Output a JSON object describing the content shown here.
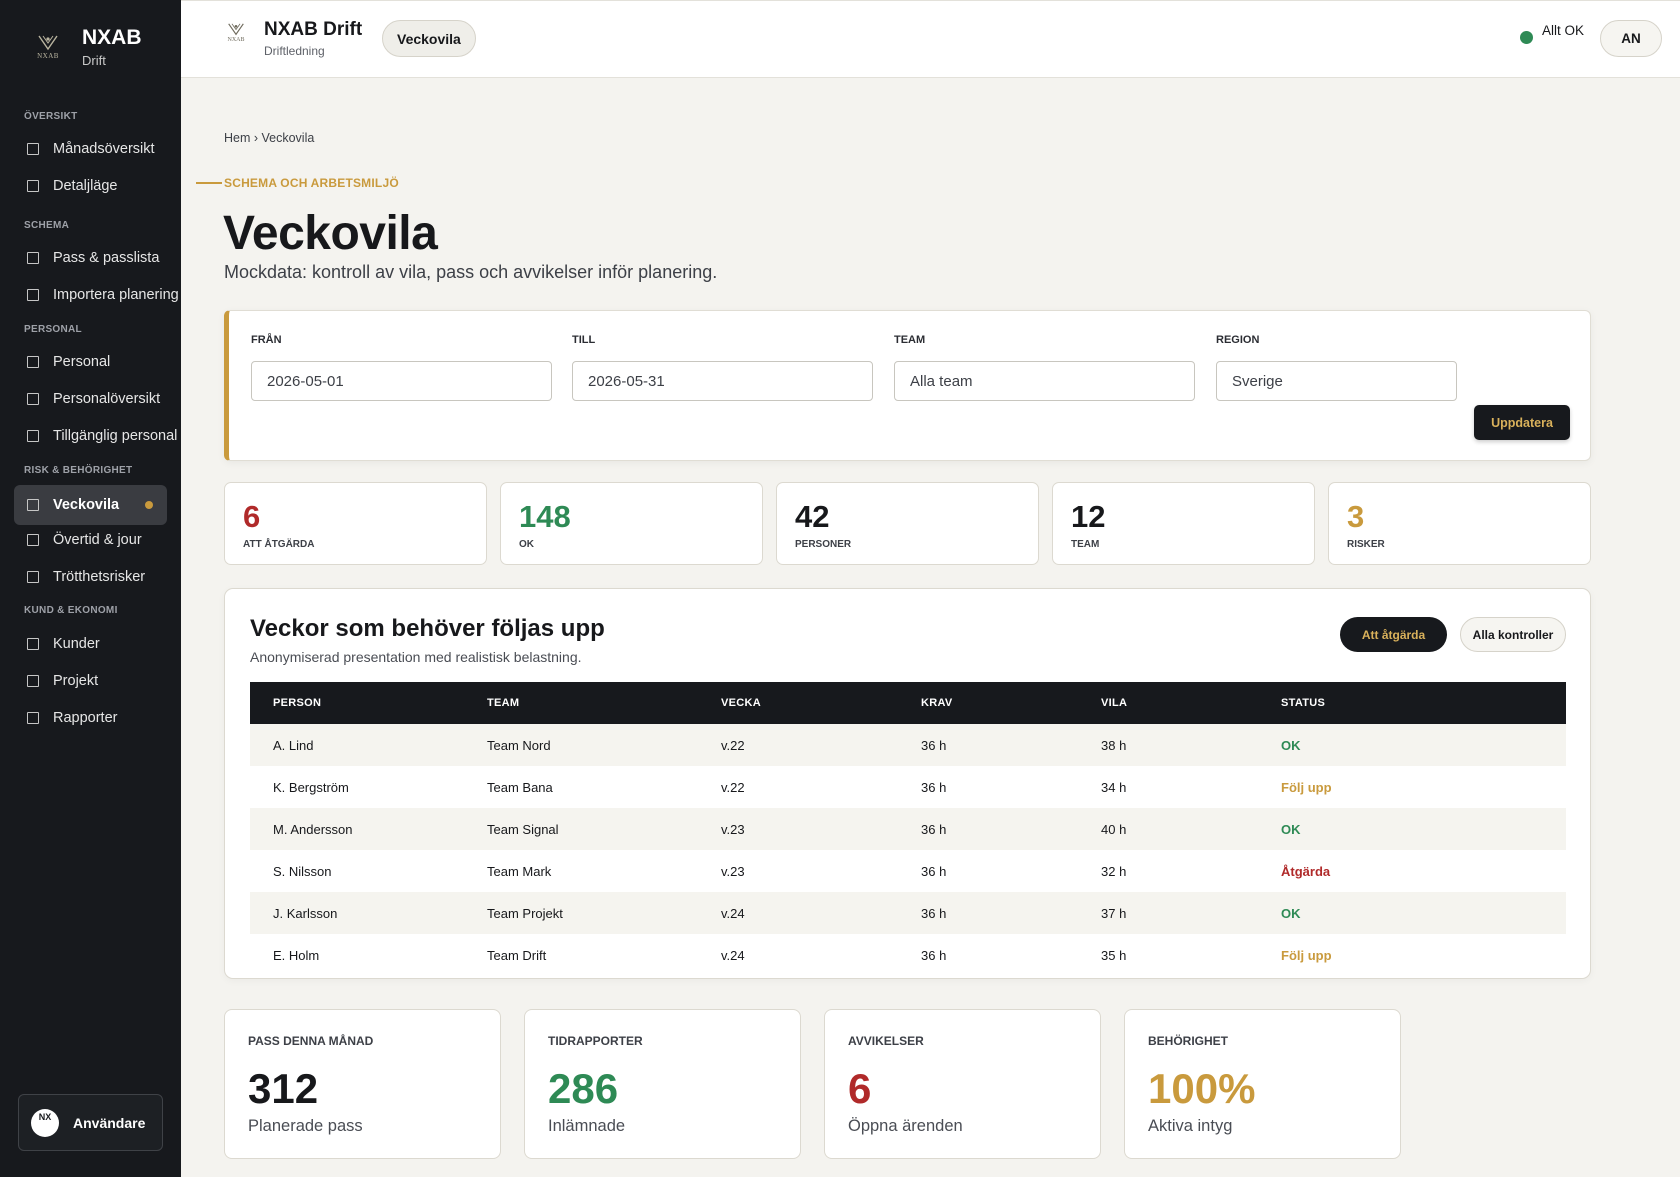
{
  "sidebar": {
    "brand_name": "NXAB",
    "brand_sub": "Drift",
    "logo_text": "NXAB",
    "sections": [
      {
        "label": "ÖVERSIKT"
      },
      {
        "label": "SCHEMA"
      },
      {
        "label": "PERSONAL"
      },
      {
        "label": "RISK & BEHÖRIGHET"
      },
      {
        "label": "KUND & EKONOMI"
      }
    ],
    "items": [
      {
        "label": "Månadsöversikt"
      },
      {
        "label": "Detaljläge"
      },
      {
        "label": "Pass & passlista"
      },
      {
        "label": "Importera planering"
      },
      {
        "label": "Personal"
      },
      {
        "label": "Personalöversikt"
      },
      {
        "label": "Tillgänglig personal"
      },
      {
        "label": "Veckovila",
        "active": true
      },
      {
        "label": "Övertid & jour"
      },
      {
        "label": "Trötthetsrisker"
      },
      {
        "label": "Kunder"
      },
      {
        "label": "Projekt"
      },
      {
        "label": "Rapporter"
      }
    ],
    "user": {
      "initials": "NX",
      "name": "Användare"
    }
  },
  "topbar": {
    "logo_text": "NXAB",
    "title": "NXAB Drift",
    "subtitle": "Driftledning",
    "pill": "Veckovila",
    "status": "Allt OK",
    "status_color": "#2e8a55",
    "avatar": "AN"
  },
  "breadcrumb": "Hem › Veckovila",
  "eyebrow": "SCHEMA OCH ARBETSMILJÖ",
  "page": {
    "title": "Veckovila",
    "description": "Mockdata: kontroll av vila, pass och avvikelser inför planering."
  },
  "filters": {
    "from": {
      "label": "FRÅN",
      "value": "2026-05-01"
    },
    "to": {
      "label": "TILL",
      "value": "2026-05-31"
    },
    "team": {
      "label": "TEAM",
      "value": "Alla team"
    },
    "region": {
      "label": "REGION",
      "value": "Sverige"
    },
    "update_button": "Uppdatera"
  },
  "kpis": [
    {
      "value": "6",
      "label": "ATT ÅTGÄRDA",
      "color": "#b02a2a"
    },
    {
      "value": "148",
      "label": "OK",
      "color": "#2e8a55"
    },
    {
      "value": "42",
      "label": "PERSONER",
      "color": "#17181b"
    },
    {
      "value": "12",
      "label": "TEAM",
      "color": "#17181b"
    },
    {
      "value": "3",
      "label": "RISKER",
      "color": "#c99a3d"
    }
  ],
  "table": {
    "title": "Veckor som behöver följas upp",
    "subtitle": "Anonymiserad presentation med realistisk belastning.",
    "btn_primary": "Att åtgärda",
    "btn_secondary": "Alla kontroller",
    "headers": [
      "PERSON",
      "TEAM",
      "VECKA",
      "KRAV",
      "VILA",
      "STATUS"
    ],
    "rows": [
      {
        "person": "A. Lind",
        "team": "Team Nord",
        "week": "v.22",
        "req": "36 h",
        "rest": "38 h",
        "status": "OK",
        "kind": "ok"
      },
      {
        "person": "K. Bergström",
        "team": "Team Bana",
        "week": "v.22",
        "req": "36 h",
        "rest": "34 h",
        "status": "Följ upp",
        "kind": "follow"
      },
      {
        "person": "M. Andersson",
        "team": "Team Signal",
        "week": "v.23",
        "req": "36 h",
        "rest": "40 h",
        "status": "OK",
        "kind": "ok"
      },
      {
        "person": "S. Nilsson",
        "team": "Team Mark",
        "week": "v.23",
        "req": "36 h",
        "rest": "32 h",
        "status": "Åtgärda",
        "kind": "act"
      },
      {
        "person": "J. Karlsson",
        "team": "Team Projekt",
        "week": "v.24",
        "req": "36 h",
        "rest": "37 h",
        "status": "OK",
        "kind": "ok"
      },
      {
        "person": "E. Holm",
        "team": "Team Drift",
        "week": "v.24",
        "req": "36 h",
        "rest": "35 h",
        "status": "Följ upp",
        "kind": "follow"
      }
    ]
  },
  "stats": [
    {
      "label": "PASS DENNA MÅNAD",
      "value": "312",
      "sub": "Planerade pass",
      "color": "#17181b"
    },
    {
      "label": "TIDRAPPORTER",
      "value": "286",
      "sub": "Inlämnade",
      "color": "#2e8a55"
    },
    {
      "label": "AVVIKELSER",
      "value": "6",
      "sub": "Öppna ärenden",
      "color": "#b02a2a"
    },
    {
      "label": "BEHÖRIGHET",
      "value": "100%",
      "sub": "Aktiva intyg",
      "color": "#c99a3d"
    }
  ]
}
